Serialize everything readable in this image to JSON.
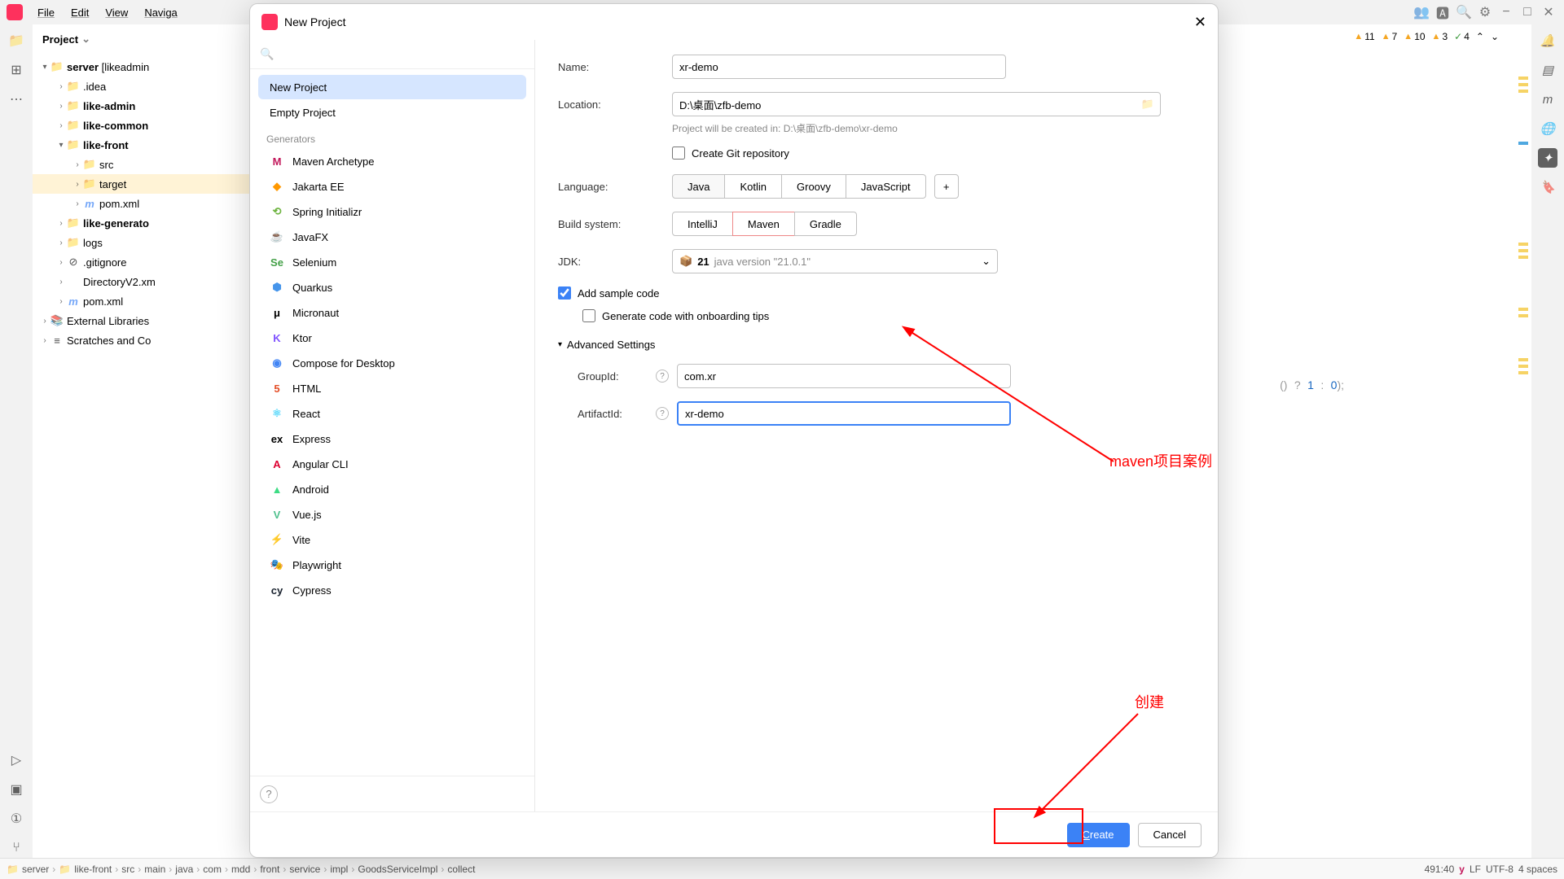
{
  "menu": {
    "file": "File",
    "edit": "Edit",
    "view": "View",
    "navigate": "Naviga"
  },
  "topIcons": [
    "👥",
    "🅰",
    "🔍",
    "⚙",
    "−",
    "□",
    "✕"
  ],
  "projectPanel": {
    "title": "Project"
  },
  "tree": {
    "root": "server",
    "rootSuffix": "[likeadmin",
    "items": [
      {
        "depth": 1,
        "chev": "",
        "icon": "📁",
        "label": ".idea"
      },
      {
        "depth": 1,
        "chev": "",
        "icon": "📁",
        "label": "like-admin",
        "bold": true
      },
      {
        "depth": 1,
        "chev": "",
        "icon": "📁",
        "label": "like-common",
        "bold": true
      },
      {
        "depth": 1,
        "chev": "▾",
        "icon": "📁",
        "label": "like-front",
        "bold": true
      },
      {
        "depth": 2,
        "chev": "",
        "icon": "📁",
        "label": "src"
      },
      {
        "depth": 2,
        "chev": "",
        "icon": "📁",
        "label": "target",
        "sel": true,
        "orange": true
      },
      {
        "depth": 2,
        "chev": "",
        "icon": "m",
        "label": "pom.xml",
        "blue": true
      },
      {
        "depth": 1,
        "chev": "",
        "icon": "📁",
        "label": "like-generato",
        "bold": true
      },
      {
        "depth": 1,
        "chev": "",
        "icon": "📁",
        "label": "logs"
      },
      {
        "depth": 1,
        "chev": "",
        "icon": "⊘",
        "label": ".gitignore"
      },
      {
        "depth": 1,
        "chev": "",
        "icon": "</>",
        "label": "DirectoryV2.xm",
        "orange": true
      },
      {
        "depth": 1,
        "chev": "",
        "icon": "m",
        "label": "pom.xml",
        "blue": true
      }
    ],
    "extLib": "External Libraries",
    "scratch": "Scratches and Co"
  },
  "inspections": [
    {
      "c": "warn",
      "n": "11"
    },
    {
      "c": "warn",
      "n": "7"
    },
    {
      "c": "warn",
      "n": "10"
    },
    {
      "c": "warn",
      "n": "3"
    },
    {
      "c": "green",
      "n": "4"
    }
  ],
  "code": {
    "paren": "()",
    "q": "?",
    "one": "1",
    "colon": ":",
    "zero": "0",
    "end": ");"
  },
  "dialog": {
    "title": "New Project",
    "sideTop": [
      "New Project",
      "Empty Project"
    ],
    "generatorsLabel": "Generators",
    "generators": [
      {
        "icon": "M",
        "color": "#c2185b",
        "label": "Maven Archetype"
      },
      {
        "icon": "◆",
        "color": "#ff9800",
        "label": "Jakarta EE"
      },
      {
        "icon": "⟲",
        "color": "#6db33f",
        "label": "Spring Initializr"
      },
      {
        "icon": "☕",
        "color": "#5382a1",
        "label": "JavaFX"
      },
      {
        "icon": "Se",
        "color": "#43a047",
        "label": "Selenium"
      },
      {
        "icon": "⬢",
        "color": "#4695eb",
        "label": "Quarkus"
      },
      {
        "icon": "μ",
        "color": "#000",
        "label": "Micronaut"
      },
      {
        "icon": "K",
        "color": "#7f52ff",
        "label": "Ktor"
      },
      {
        "icon": "◉",
        "color": "#4285f4",
        "label": "Compose for Desktop"
      },
      {
        "icon": "5",
        "color": "#e44d26",
        "label": "HTML"
      },
      {
        "icon": "⚛",
        "color": "#61dafb",
        "label": "React"
      },
      {
        "icon": "ex",
        "color": "#000",
        "label": "Express"
      },
      {
        "icon": "A",
        "color": "#dd0031",
        "label": "Angular CLI"
      },
      {
        "icon": "▲",
        "color": "#3ddc84",
        "label": "Android"
      },
      {
        "icon": "V",
        "color": "#4fc08d",
        "label": "Vue.js"
      },
      {
        "icon": "⚡",
        "color": "#646cff",
        "label": "Vite"
      },
      {
        "icon": "🎭",
        "color": "#2ead33",
        "label": "Playwright"
      },
      {
        "icon": "cy",
        "color": "#17202c",
        "label": "Cypress"
      }
    ],
    "form": {
      "nameLabel": "Name:",
      "name": "xr-demo",
      "locationLabel": "Location:",
      "location": "D:\\桌面\\zfb-demo",
      "locationHint": "Project will be created in: D:\\桌面\\zfb-demo\\xr-demo",
      "gitLabel": "Create Git repository",
      "languageLabel": "Language:",
      "languages": [
        "Java",
        "Kotlin",
        "Groovy",
        "JavaScript"
      ],
      "buildLabel": "Build system:",
      "builds": [
        "IntelliJ",
        "Maven",
        "Gradle"
      ],
      "jdkLabel": "JDK:",
      "jdkVersion": "21",
      "jdkText": "java version \"21.0.1\"",
      "sampleLabel": "Add sample code",
      "onboardLabel": "Generate code with onboarding tips",
      "advLabel": "Advanced Settings",
      "groupLabel": "GroupId:",
      "groupId": "com.xr",
      "artifactLabel": "ArtifactId:",
      "artifactId": "xr-demo"
    },
    "buttons": {
      "create": "Create",
      "cancel": "Cancel",
      "createU": "C",
      "createRest": "reate"
    }
  },
  "annotations": {
    "maven": "maven项目案例",
    "create": "创建"
  },
  "breadcrumb": [
    "server",
    "like-front",
    "src",
    "main",
    "java",
    "com",
    "mdd",
    "front",
    "service",
    "impl",
    "GoodsServiceImpl",
    "collect"
  ],
  "status": {
    "pos": "491:40",
    "y": "y",
    "lf": "LF",
    "enc": "UTF-8",
    "sp": "4 spaces"
  }
}
